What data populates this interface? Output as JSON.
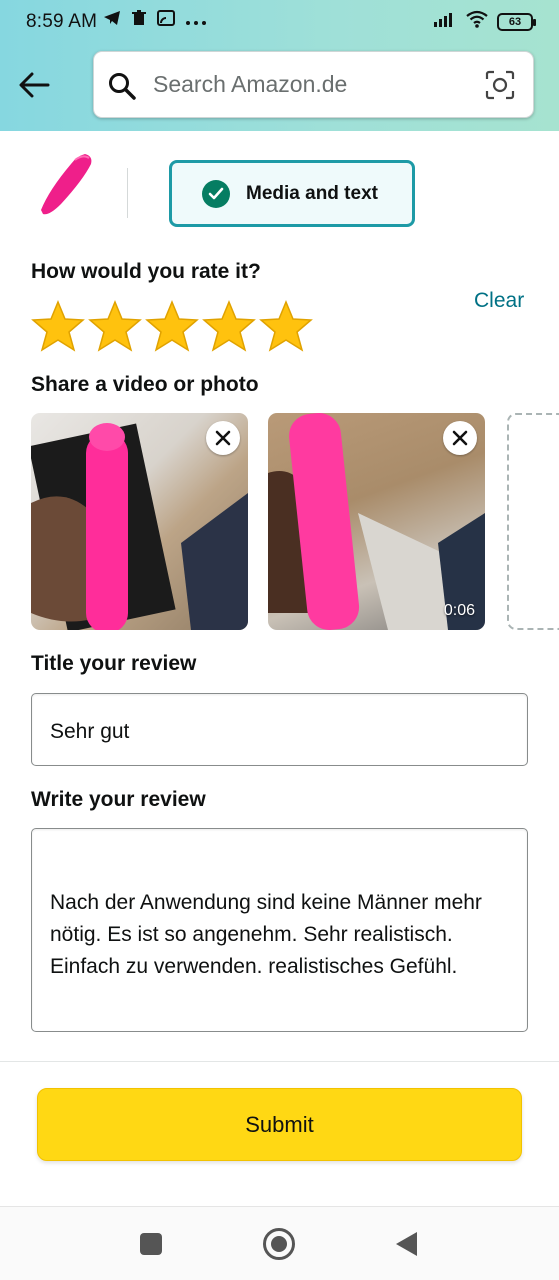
{
  "status_bar": {
    "time": "8:59 AM",
    "icons": [
      "telegram-icon",
      "trash-icon",
      "cast-icon",
      "more-dots-icon"
    ],
    "right_icons": [
      "signal-icon",
      "wifi-icon",
      "battery-icon"
    ],
    "battery_level": "63"
  },
  "search": {
    "placeholder": "Search Amazon.de",
    "icon": "search-icon",
    "camera_icon": "camera-icon"
  },
  "product": {
    "thumbnail_icon": "product-thumbnail"
  },
  "mode_chip": {
    "label": "Media and text",
    "selected": true
  },
  "rating": {
    "question": "How would you rate it?",
    "clear_label": "Clear",
    "stars": 5,
    "max_stars": 5,
    "star_color": "#ffc20e"
  },
  "media": {
    "heading": "Share a video or photo",
    "items": [
      {
        "type": "photo"
      },
      {
        "type": "video",
        "duration": "0:06"
      }
    ]
  },
  "title_field": {
    "label": "Title your review",
    "value": "Sehr gut"
  },
  "review_field": {
    "label": "Write your review",
    "value": "Nach der Anwendung sind keine Männer mehr nötig. Es ist so angenehm. Sehr realistisch. Einfach zu verwenden. realistisches Gefühl."
  },
  "submit": {
    "label": "Submit",
    "color": "#ffd814"
  },
  "colors": {
    "accent_teal": "#1d9aa6",
    "link": "#007185",
    "check_green": "#067d62"
  }
}
